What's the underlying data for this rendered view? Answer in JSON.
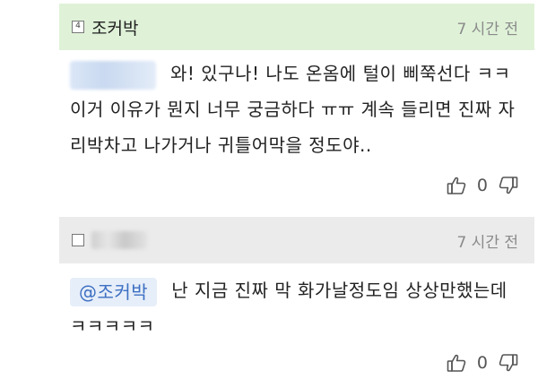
{
  "comments": [
    {
      "author": "조커박",
      "time": "7 시간 전",
      "mention": "",
      "text_lines": [
        "와! 있구나! 나도 온옴에 털이 삐쭉선다 ㅋㅋ",
        "이거 이유가 뭔지 너무 궁금하다 ㅠㅠ 계속 들리면 진짜 자",
        "리박차고 나가거나 귀틀어막을 정도야.."
      ],
      "upvotes": "0"
    },
    {
      "author": "",
      "time": "7 시간 전",
      "mention": "@조커박",
      "text_lines": [
        "난 지금 진짜 막 화가날정도임 상상만했는데",
        "ㅋㅋㅋㅋㅋ"
      ],
      "upvotes": "0"
    }
  ],
  "icons": {
    "level": "level-badge-icon",
    "like": "thumbs-up-icon",
    "dislike": "thumbs-down-icon"
  },
  "colors": {
    "header_highlight": "#dff2d8",
    "header_default": "#ebebeb",
    "mention_bg": "#e6eef9",
    "mention_text": "#3d6fc2"
  }
}
